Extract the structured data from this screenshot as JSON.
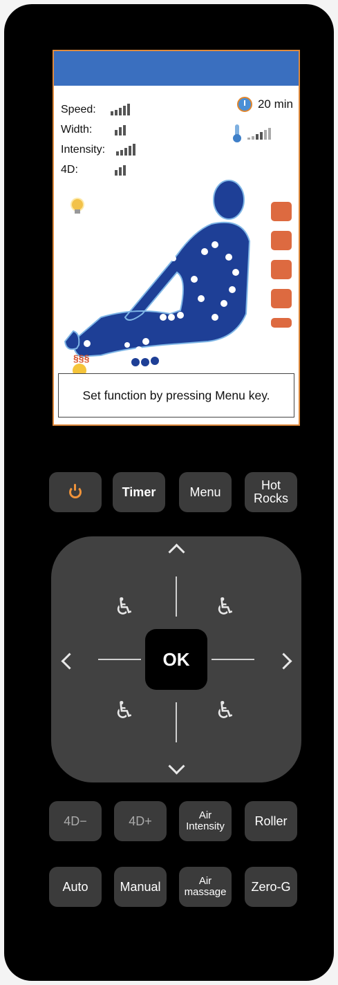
{
  "screen": {
    "settings": [
      {
        "label": "Speed:",
        "level": 4,
        "max": 5
      },
      {
        "label": "Width:",
        "level": 3,
        "max": 3
      },
      {
        "label": "Intensity:",
        "level": 5,
        "max": 5
      },
      {
        "label": "4D:",
        "level": 3,
        "max": 3
      }
    ],
    "timer": {
      "value": "20 min",
      "icon": "alarm-clock-icon"
    },
    "temperature": {
      "icon": "thermometer-icon",
      "level": 3,
      "max": 6
    },
    "side_icons": [
      "neck-shoulder-icon",
      "back-icon",
      "waist-icon",
      "seat-icon",
      "leg-icon"
    ],
    "message": "Set function by pressing Menu key.",
    "colors": {
      "header": "#3a6fbf",
      "border": "#e08a3c",
      "body": "#1e3f96",
      "accent": "#d95a2b"
    }
  },
  "buttons": {
    "row1": {
      "timer": "Timer",
      "menu": "Menu",
      "hot_rocks": "Hot Rocks"
    },
    "dpad": {
      "ok": "OK"
    },
    "row2": {
      "minus_4d": "4D−",
      "plus_4d": "4D+",
      "air_intensity": "Air Intensity",
      "roller": "Roller"
    },
    "row3": {
      "auto": "Auto",
      "manual": "Manual",
      "air_massage": "Air massage",
      "zero_g": "Zero-G"
    }
  }
}
